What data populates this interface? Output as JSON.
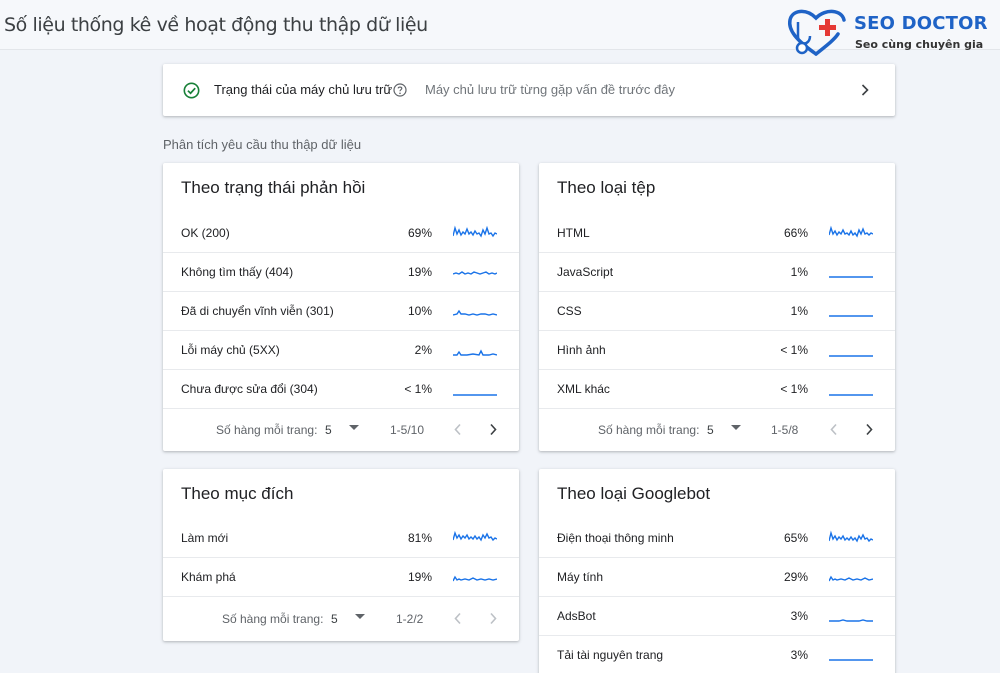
{
  "header": {
    "title": "Số liệu thống kê về hoạt động thu thập dữ liệu",
    "logo": {
      "name": "SEO DOCTOR",
      "tagline": "Seo cùng chuyên gia",
      "brand_color": "#1f63c6",
      "accent_color": "#e53935"
    }
  },
  "host_status": {
    "label": "Trạng thái của máy chủ lưu trữ",
    "message": "Máy chủ lưu trữ từng gặp vấn đề trước đây",
    "icon": "check-circle-icon",
    "status_color": "#188038"
  },
  "section_label": "Phân tích yêu cầu thu thập dữ liệu",
  "pager_label": "Số hàng mỗi trang:",
  "cards": {
    "response": {
      "title": "Theo trạng thái phản hồi",
      "rows": [
        {
          "label": "OK (200)",
          "value": "69%"
        },
        {
          "label": "Không tìm thấy (404)",
          "value": "19%"
        },
        {
          "label": "Đã di chuyển vĩnh viễn (301)",
          "value": "10%"
        },
        {
          "label": "Lỗi máy chủ (5XX)",
          "value": "2%"
        },
        {
          "label": "Chưa được sửa đổi (304)",
          "value": "< 1%"
        }
      ],
      "rows_per_page": "5",
      "range": "1-5/10"
    },
    "filetype": {
      "title": "Theo loại tệp",
      "rows": [
        {
          "label": "HTML",
          "value": "66%"
        },
        {
          "label": "JavaScript",
          "value": "1%"
        },
        {
          "label": "CSS",
          "value": "1%"
        },
        {
          "label": "Hình ảnh",
          "value": "< 1%"
        },
        {
          "label": "XML khác",
          "value": "< 1%"
        }
      ],
      "rows_per_page": "5",
      "range": "1-5/8"
    },
    "purpose": {
      "title": "Theo mục đích",
      "rows": [
        {
          "label": "Làm mới",
          "value": "81%"
        },
        {
          "label": "Khám phá",
          "value": "19%"
        }
      ],
      "rows_per_page": "5",
      "range": "1-2/2"
    },
    "googlebot": {
      "title": "Theo loại Googlebot",
      "rows": [
        {
          "label": "Điện thoại thông minh",
          "value": "65%"
        },
        {
          "label": "Máy tính",
          "value": "29%"
        },
        {
          "label": "AdsBot",
          "value": "3%"
        },
        {
          "label": "Tải tài nguyên trang",
          "value": "3%"
        }
      ]
    }
  },
  "sparkline_color": "#1a73e8"
}
